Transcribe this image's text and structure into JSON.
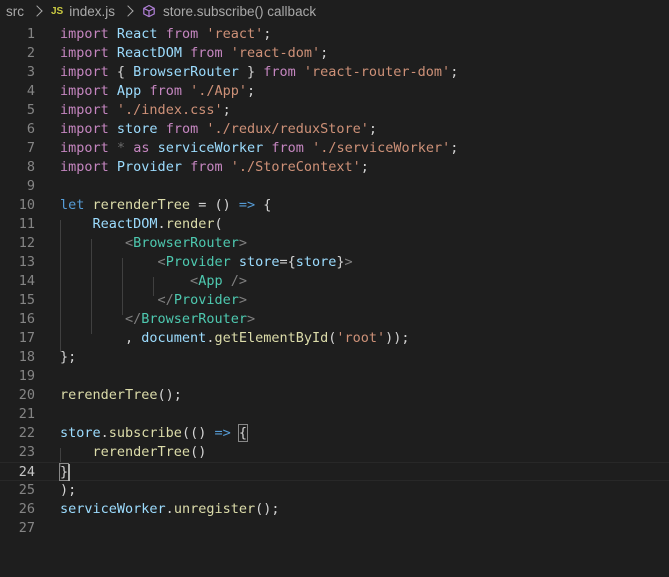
{
  "breadcrumb": {
    "folder": "src",
    "file": "index.js",
    "file_icon": "JS",
    "symbol": "store.subscribe() callback"
  },
  "editor": {
    "current_line": 24,
    "lines": [
      {
        "n": "1",
        "tokens": [
          [
            "kw",
            "import"
          ],
          [
            "pun",
            " "
          ],
          [
            "var",
            "React"
          ],
          [
            "pun",
            " "
          ],
          [
            "kw",
            "from"
          ],
          [
            "pun",
            " "
          ],
          [
            "str",
            "'react'"
          ],
          [
            "pun",
            ";"
          ]
        ]
      },
      {
        "n": "2",
        "tokens": [
          [
            "kw",
            "import"
          ],
          [
            "pun",
            " "
          ],
          [
            "var",
            "ReactDOM"
          ],
          [
            "pun",
            " "
          ],
          [
            "kw",
            "from"
          ],
          [
            "pun",
            " "
          ],
          [
            "str",
            "'react-dom'"
          ],
          [
            "pun",
            ";"
          ]
        ]
      },
      {
        "n": "3",
        "tokens": [
          [
            "kw",
            "import"
          ],
          [
            "pun",
            " { "
          ],
          [
            "var",
            "BrowserRouter"
          ],
          [
            "pun",
            " } "
          ],
          [
            "kw",
            "from"
          ],
          [
            "pun",
            " "
          ],
          [
            "str",
            "'react-router-dom'"
          ],
          [
            "pun",
            ";"
          ]
        ]
      },
      {
        "n": "4",
        "tokens": [
          [
            "kw",
            "import"
          ],
          [
            "pun",
            " "
          ],
          [
            "var",
            "App"
          ],
          [
            "pun",
            " "
          ],
          [
            "kw",
            "from"
          ],
          [
            "pun",
            " "
          ],
          [
            "str",
            "'./App'"
          ],
          [
            "pun",
            ";"
          ]
        ]
      },
      {
        "n": "5",
        "tokens": [
          [
            "kw",
            "import"
          ],
          [
            "pun",
            " "
          ],
          [
            "str",
            "'./index.css'"
          ],
          [
            "pun",
            ";"
          ]
        ]
      },
      {
        "n": "6",
        "tokens": [
          [
            "kw",
            "import"
          ],
          [
            "pun",
            " "
          ],
          [
            "var",
            "store"
          ],
          [
            "pun",
            " "
          ],
          [
            "kw",
            "from"
          ],
          [
            "pun",
            " "
          ],
          [
            "str",
            "'./redux/reduxStore'"
          ],
          [
            "pun",
            ";"
          ]
        ]
      },
      {
        "n": "7",
        "tokens": [
          [
            "kw",
            "import"
          ],
          [
            "pun",
            " "
          ],
          [
            "dim",
            "*"
          ],
          [
            "pun",
            " "
          ],
          [
            "kw",
            "as"
          ],
          [
            "pun",
            " "
          ],
          [
            "var",
            "serviceWorker"
          ],
          [
            "pun",
            " "
          ],
          [
            "kw",
            "from"
          ],
          [
            "pun",
            " "
          ],
          [
            "str",
            "'./serviceWorker'"
          ],
          [
            "pun",
            ";"
          ]
        ]
      },
      {
        "n": "8",
        "tokens": [
          [
            "kw",
            "import"
          ],
          [
            "pun",
            " "
          ],
          [
            "var",
            "Provider"
          ],
          [
            "pun",
            " "
          ],
          [
            "kw",
            "from"
          ],
          [
            "pun",
            " "
          ],
          [
            "str",
            "'./StoreContext'"
          ],
          [
            "pun",
            ";"
          ]
        ]
      },
      {
        "n": "9",
        "tokens": []
      },
      {
        "n": "10",
        "tokens": [
          [
            "dkw",
            "let"
          ],
          [
            "pun",
            " "
          ],
          [
            "fn",
            "rerenderTree"
          ],
          [
            "pun",
            " = () "
          ],
          [
            "dkw",
            "=>"
          ],
          [
            "pun",
            " {"
          ]
        ]
      },
      {
        "n": "11",
        "tokens": [
          [
            "pun",
            "    "
          ],
          [
            "var",
            "ReactDOM"
          ],
          [
            "pun",
            "."
          ],
          [
            "fn",
            "render"
          ],
          [
            "pun",
            "("
          ]
        ]
      },
      {
        "n": "12",
        "tokens": [
          [
            "pun",
            "        "
          ],
          [
            "tag",
            "<"
          ],
          [
            "comp",
            "BrowserRouter"
          ],
          [
            "tag",
            ">"
          ]
        ]
      },
      {
        "n": "13",
        "tokens": [
          [
            "pun",
            "            "
          ],
          [
            "tag",
            "<"
          ],
          [
            "comp",
            "Provider"
          ],
          [
            "pun",
            " "
          ],
          [
            "attr",
            "store"
          ],
          [
            "pun",
            "={"
          ],
          [
            "var",
            "store"
          ],
          [
            "pun",
            "}"
          ],
          [
            "tag",
            ">"
          ]
        ]
      },
      {
        "n": "14",
        "tokens": [
          [
            "pun",
            "                "
          ],
          [
            "tag",
            "<"
          ],
          [
            "comp",
            "App"
          ],
          [
            "pun",
            " "
          ],
          [
            "tag",
            "/>"
          ]
        ]
      },
      {
        "n": "15",
        "tokens": [
          [
            "pun",
            "            "
          ],
          [
            "tag",
            "</"
          ],
          [
            "comp",
            "Provider"
          ],
          [
            "tag",
            ">"
          ]
        ]
      },
      {
        "n": "16",
        "tokens": [
          [
            "pun",
            "        "
          ],
          [
            "tag",
            "</"
          ],
          [
            "comp",
            "BrowserRouter"
          ],
          [
            "tag",
            ">"
          ]
        ]
      },
      {
        "n": "17",
        "tokens": [
          [
            "pun",
            "        , "
          ],
          [
            "var",
            "document"
          ],
          [
            "pun",
            "."
          ],
          [
            "fn",
            "getElementById"
          ],
          [
            "pun",
            "("
          ],
          [
            "str",
            "'root'"
          ],
          [
            "pun",
            "));"
          ]
        ]
      },
      {
        "n": "18",
        "tokens": [
          [
            "pun",
            "};"
          ]
        ]
      },
      {
        "n": "19",
        "tokens": []
      },
      {
        "n": "20",
        "tokens": [
          [
            "fn",
            "rerenderTree"
          ],
          [
            "pun",
            "();"
          ]
        ]
      },
      {
        "n": "21",
        "tokens": []
      },
      {
        "n": "22",
        "tokens": [
          [
            "var",
            "store"
          ],
          [
            "pun",
            "."
          ],
          [
            "fn",
            "subscribe"
          ],
          [
            "pun",
            "(() "
          ],
          [
            "dkw",
            "=>"
          ],
          [
            "pun",
            " "
          ],
          [
            "bm",
            "{"
          ]
        ]
      },
      {
        "n": "23",
        "tokens": [
          [
            "pun",
            "    "
          ],
          [
            "fn",
            "rerenderTree"
          ],
          [
            "pun",
            "()"
          ]
        ]
      },
      {
        "n": "24",
        "tokens": [
          [
            "bm",
            "}"
          ]
        ]
      },
      {
        "n": "25",
        "tokens": [
          [
            "pun",
            ");"
          ]
        ]
      },
      {
        "n": "26",
        "tokens": [
          [
            "var",
            "serviceWorker"
          ],
          [
            "pun",
            "."
          ],
          [
            "fn",
            "unregister"
          ],
          [
            "pun",
            "();"
          ]
        ]
      },
      {
        "n": "27",
        "tokens": []
      }
    ]
  }
}
